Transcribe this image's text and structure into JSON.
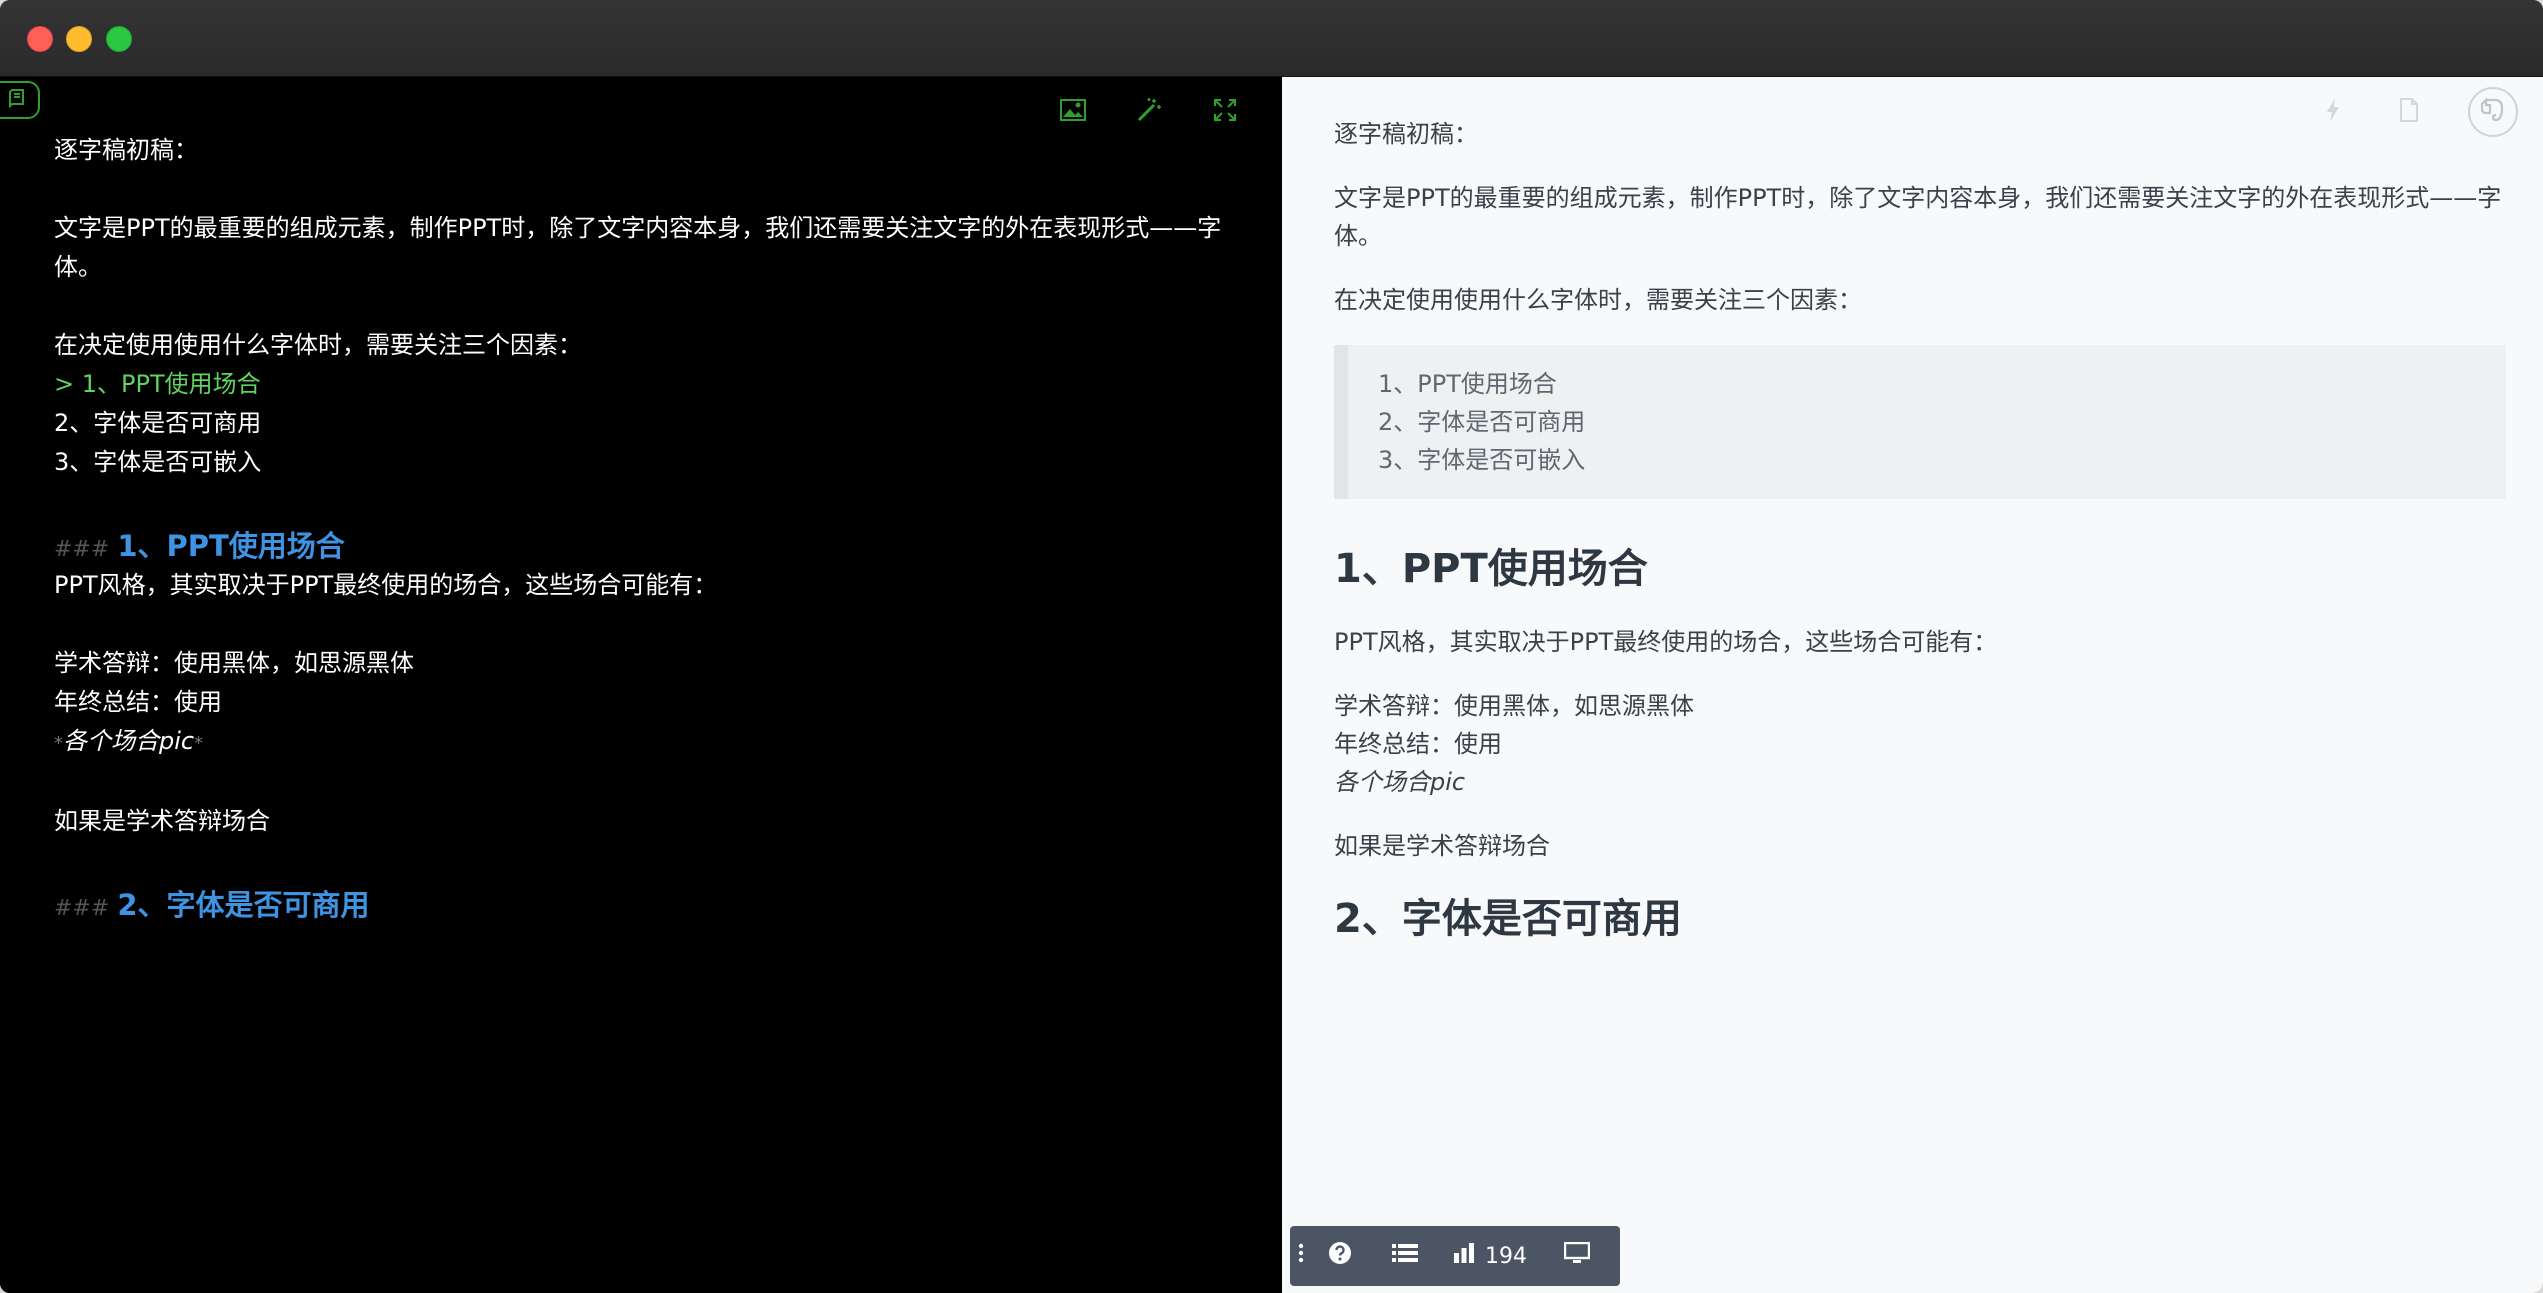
{
  "editor": {
    "lines": [
      {
        "type": "p",
        "text": "逐字稿初稿："
      },
      {
        "type": "blank",
        "text": ""
      },
      {
        "type": "p",
        "text": "文字是PPT的最重要的组成元素，制作PPT时，除了文字内容本身，我们还需要关注文字的外在表现形式——字体。"
      },
      {
        "type": "blank",
        "text": ""
      },
      {
        "type": "p",
        "text": "在决定使用使用什么字体时，需要关注三个因素："
      },
      {
        "type": "quote",
        "text": "> 1、PPT使用场合"
      },
      {
        "type": "p",
        "text": "2、字体是否可商用"
      },
      {
        "type": "p",
        "text": "3、字体是否可嵌入"
      }
    ],
    "heading1_marker": "###",
    "heading1": "1、PPT使用场合",
    "para2": "PPT风格，其实取决于PPT最终使用的场合，这些场合可能有：",
    "line_academic": "学术答辩：使用黑体，如思源黑体",
    "line_yearend": "年终总结：使用",
    "emph_marker": "*",
    "emph_text": "各个场合pic",
    "line_if": "如果是学术答辩场合",
    "heading2_marker": "###",
    "heading2": "2、字体是否可商用"
  },
  "preview": {
    "p1": "逐字稿初稿：",
    "p2": "文字是PPT的最重要的组成元素，制作PPT时，除了文字内容本身，我们还需要关注文字的外在表现形式——字体。",
    "p3": "在决定使用使用什么字体时，需要关注三个因素：",
    "quote": [
      "1、PPT使用场合",
      "2、字体是否可商用",
      "3、字体是否可嵌入"
    ],
    "h1": "1、PPT使用场合",
    "p4": "PPT风格，其实取决于PPT最终使用的场合，这些场合可能有：",
    "l1": "学术答辩：使用黑体，如思源黑体",
    "l2": "年终总结：使用",
    "l3": "各个场合pic",
    "p5": "如果是学术答辩场合",
    "h2": "2、字体是否可商用"
  },
  "statusbar": {
    "word_count": "194"
  },
  "icons": {
    "editor_badge": "notebook-icon",
    "image": "image-icon",
    "magic": "magic-wand-icon",
    "fullscreen": "expand-icon",
    "lightning": "lightning-icon",
    "document": "document-icon",
    "evernote": "evernote-icon",
    "help": "help-icon",
    "list": "list-icon",
    "chart": "bar-chart-icon",
    "monitor": "monitor-icon"
  },
  "colors": {
    "accent_green": "#2ea02e",
    "heading_blue": "#3e94e3",
    "quote_green": "#5fd35f",
    "preview_bg": "#f8f9fa",
    "statusbar_bg": "#4b5563"
  }
}
